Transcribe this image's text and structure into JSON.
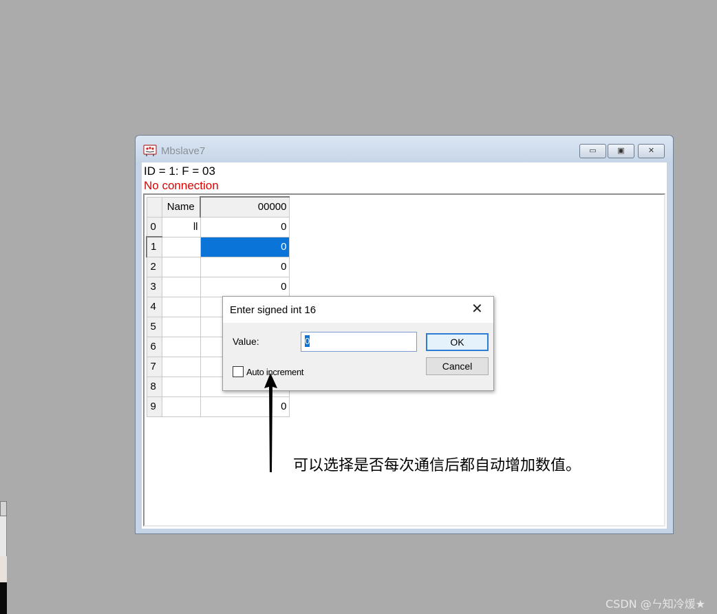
{
  "window": {
    "title": "Mbslave7",
    "min_glyph": "▭",
    "max_glyph": "▣",
    "close_glyph": "✕"
  },
  "info": {
    "id_line": "ID = 1: F = 03",
    "status": "No connection"
  },
  "grid": {
    "headers": [
      "",
      "Name",
      "00000"
    ],
    "rows": [
      {
        "row": "0",
        "name": "ll",
        "value": "0"
      },
      {
        "row": "1",
        "name": "",
        "value": "0"
      },
      {
        "row": "2",
        "name": "",
        "value": "0"
      },
      {
        "row": "3",
        "name": "",
        "value": "0"
      },
      {
        "row": "4",
        "name": "",
        "value": ""
      },
      {
        "row": "5",
        "name": "",
        "value": ""
      },
      {
        "row": "6",
        "name": "",
        "value": ""
      },
      {
        "row": "7",
        "name": "",
        "value": ""
      },
      {
        "row": "8",
        "name": "",
        "value": ""
      },
      {
        "row": "9",
        "name": "",
        "value": "0"
      }
    ],
    "selected_row": "1"
  },
  "dialog": {
    "title": "Enter signed int 16",
    "close_glyph": "✕",
    "value_label": "Value:",
    "value": "0",
    "ok_label": "OK",
    "cancel_label": "Cancel",
    "auto_increment_label": "Auto increment",
    "auto_increment_checked": false
  },
  "annotation": "可以选择是否每次通信后都自动增加数值。",
  "watermark": "CSDN @ㄣ知冷煖★",
  "colors": {
    "selection": "#0a74d8",
    "status_red": "#e00000",
    "desktop": "#ababab"
  }
}
